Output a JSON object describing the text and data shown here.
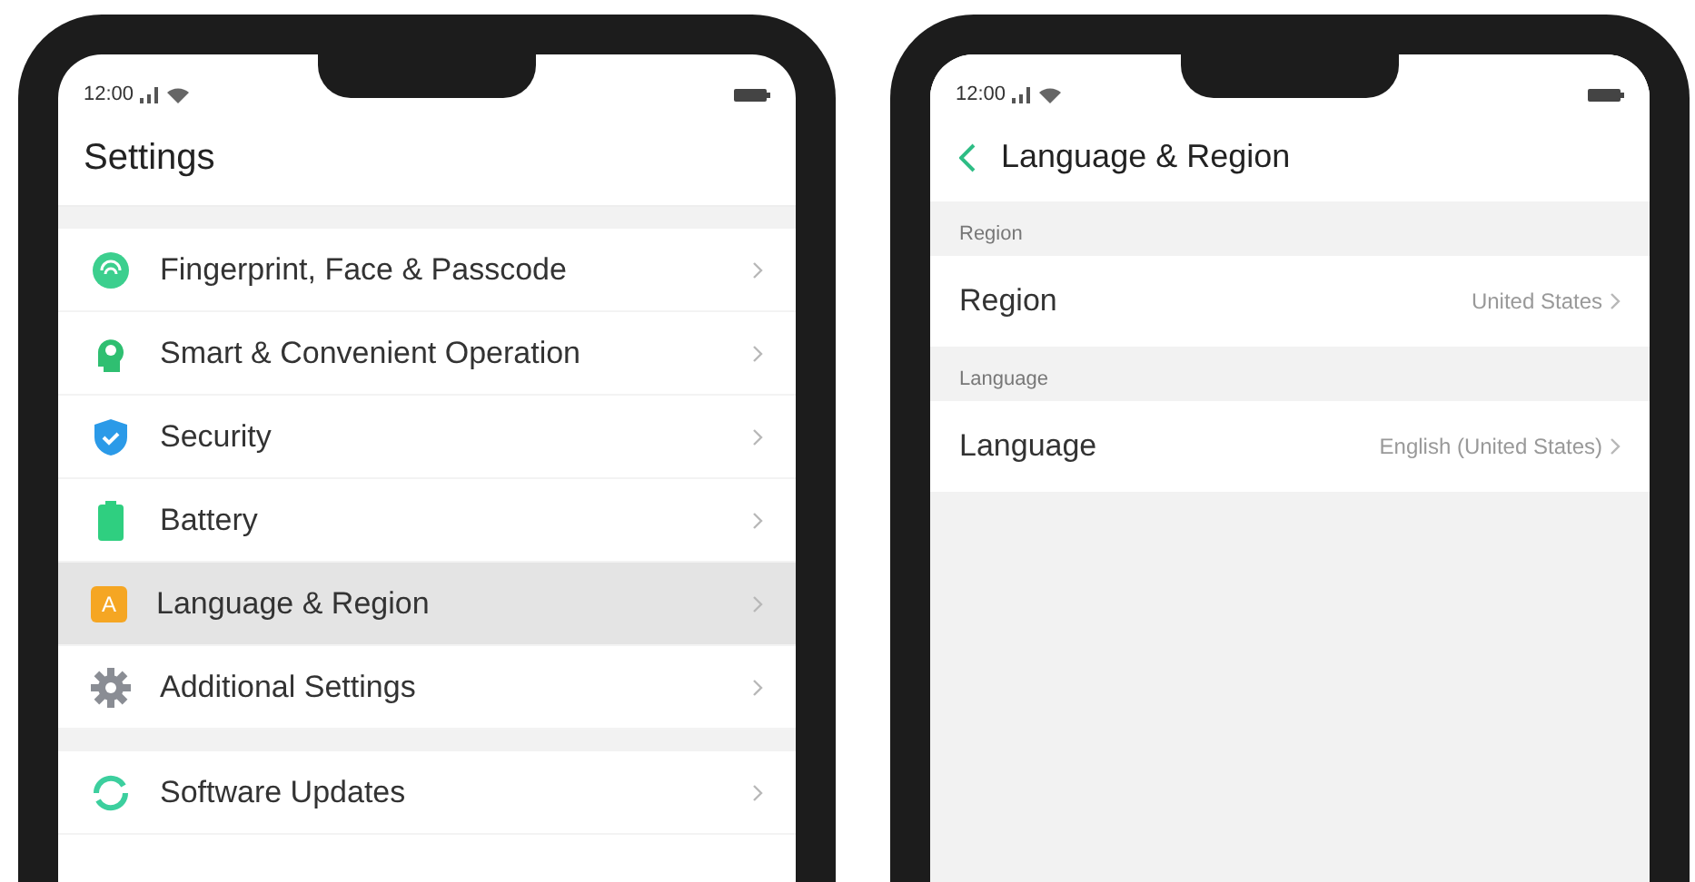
{
  "settings_screen": {
    "status_bar": {
      "time": "12:00"
    },
    "title": "Settings",
    "groups": [
      {
        "items": [
          {
            "label": "Fingerprint, Face & Passcode",
            "kind": "fingerprint",
            "selected": false
          },
          {
            "label": "Smart & Convenient Operation",
            "kind": "smart",
            "selected": false
          },
          {
            "label": "Security",
            "kind": "shield",
            "selected": false
          },
          {
            "label": "Battery",
            "kind": "battery",
            "selected": false
          },
          {
            "label": "Language & Region",
            "kind": "letter",
            "icon_text": "A",
            "selected": true
          },
          {
            "label": "Additional Settings",
            "kind": "gear",
            "selected": false
          }
        ]
      },
      {
        "items": [
          {
            "label": "Software Updates",
            "kind": "update",
            "selected": false
          }
        ]
      }
    ]
  },
  "language_screen": {
    "status_bar": {
      "time": "12:00"
    },
    "title": "Language & Region",
    "sections": [
      {
        "header": "Region",
        "label": "Region",
        "value": "United States"
      },
      {
        "header": "Language",
        "label": "Language",
        "value": "English (United States)"
      }
    ]
  }
}
